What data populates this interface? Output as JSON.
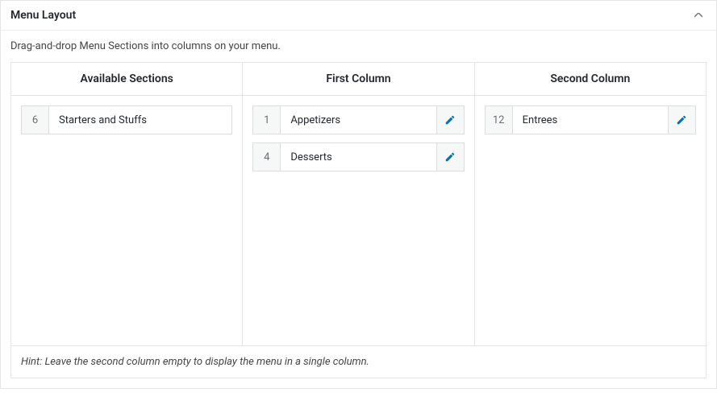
{
  "panel": {
    "title": "Menu Layout",
    "description": "Drag-and-drop Menu Sections into columns on your menu.",
    "hint": "Hint: Leave the second column empty to display the menu in a single column."
  },
  "columns": {
    "available": {
      "header": "Available Sections",
      "items": [
        {
          "num": "6",
          "label": "Starters and Stuffs",
          "editable": false
        }
      ]
    },
    "first": {
      "header": "First Column",
      "items": [
        {
          "num": "1",
          "label": "Appetizers",
          "editable": true
        },
        {
          "num": "4",
          "label": "Desserts",
          "editable": true
        }
      ]
    },
    "second": {
      "header": "Second Column",
      "items": [
        {
          "num": "12",
          "label": "Entrees",
          "editable": true
        }
      ]
    }
  }
}
